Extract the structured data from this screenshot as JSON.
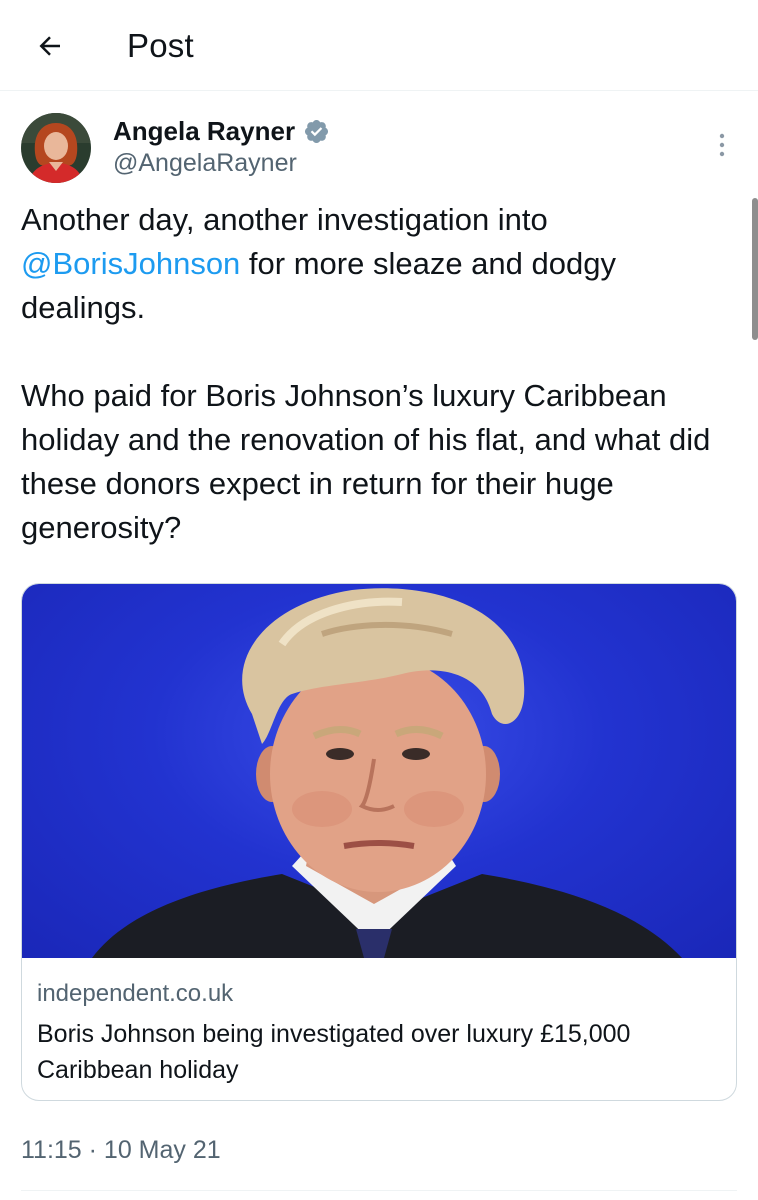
{
  "header": {
    "title": "Post"
  },
  "author": {
    "display_name": "Angela Rayner",
    "handle": "@AngelaRayner",
    "verified": true
  },
  "tweet": {
    "paragraph1_before": "Another day, another investigation into ",
    "mention": "@BorisJohnson",
    "paragraph1_after": " for more sleaze and dodgy dealings.",
    "paragraph2": "Who paid for Boris Johnson’s luxury Caribbean holiday and the renovation of his flat, and what did these donors expect in return for their huge generosity?"
  },
  "link_card": {
    "domain": "independent.co.uk",
    "title": "Boris Johnson being investigated over luxury £15,000 Caribbean holiday"
  },
  "meta": {
    "timestamp": "11:15 · 10 May 21"
  },
  "colors": {
    "link": "#1d9bf0",
    "secondary_text": "#536471",
    "verified_badge": "#829aab"
  }
}
